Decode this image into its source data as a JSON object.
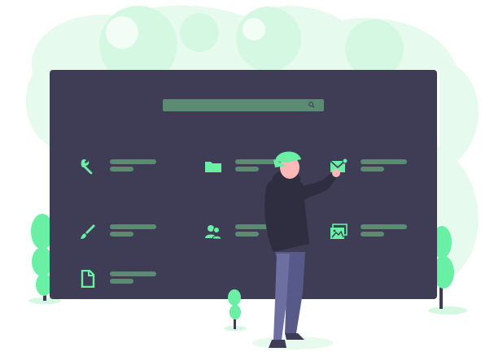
{
  "illustration": {
    "accent_color": "#69f0a4",
    "board_color": "#3f3d56",
    "placeholder_bar_color": "#5b8c73",
    "background_blob_color": "#e6fbee"
  },
  "search": {
    "icon": "search-icon"
  },
  "apps": [
    {
      "icon": "wrench-icon"
    },
    {
      "icon": "folder-icon"
    },
    {
      "icon": "mail-icon"
    },
    {
      "icon": "brush-icon"
    },
    {
      "icon": "users-icon"
    },
    {
      "icon": "images-icon"
    },
    {
      "icon": "document-icon"
    }
  ],
  "character": {
    "pose": "person-pressing-mail-tile"
  }
}
